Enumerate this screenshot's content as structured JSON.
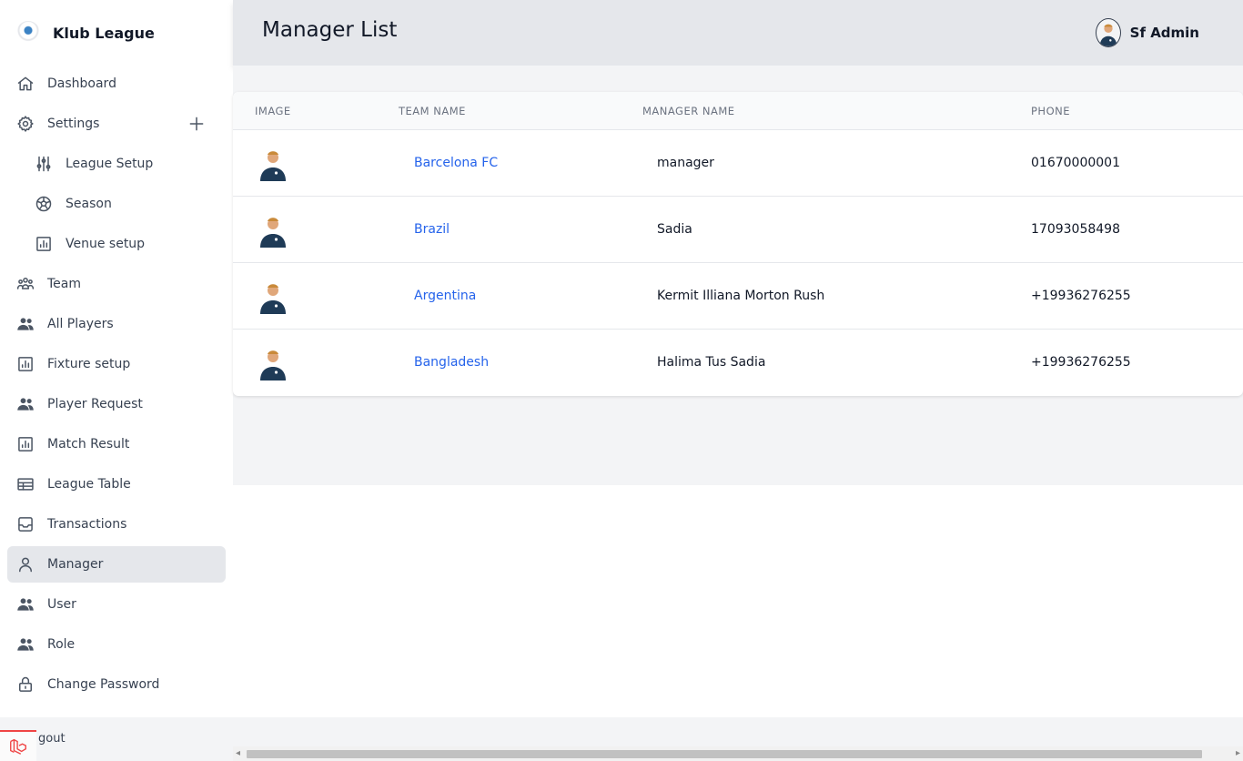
{
  "app": {
    "brand_name": "Klub League",
    "page_title": "Manager List",
    "user_name": "Sf Admin"
  },
  "sidebar": {
    "items": [
      {
        "label": "Dashboard",
        "icon": "home-icon"
      },
      {
        "label": "Settings",
        "icon": "gear-icon"
      },
      {
        "label": "League Setup",
        "icon": "sliders-icon"
      },
      {
        "label": "Season",
        "icon": "soccer-ball-icon"
      },
      {
        "label": "Venue setup",
        "icon": "chart-icon"
      },
      {
        "label": "Team",
        "icon": "team-icon"
      },
      {
        "label": "All Players",
        "icon": "users-icon"
      },
      {
        "label": "Fixture setup",
        "icon": "chart-icon"
      },
      {
        "label": "Player Request",
        "icon": "users-icon"
      },
      {
        "label": "Match Result",
        "icon": "chart-icon"
      },
      {
        "label": "League Table",
        "icon": "table-icon"
      },
      {
        "label": "Transactions",
        "icon": "inbox-icon"
      },
      {
        "label": "Manager",
        "icon": "user-icon"
      },
      {
        "label": "User",
        "icon": "users-icon"
      },
      {
        "label": "Role",
        "icon": "users-icon"
      },
      {
        "label": "Change Password",
        "icon": "lock-icon"
      }
    ],
    "logout_label": "gout"
  },
  "table": {
    "headers": {
      "image": "IMAGE",
      "team_name": "TEAM NAME",
      "manager_name": "MANAGER NAME",
      "phone": "PHONE"
    },
    "rows": [
      {
        "team": "Barcelona FC",
        "manager": "manager",
        "phone": "01670000001"
      },
      {
        "team": "Brazil",
        "manager": "Sadia",
        "phone": "17093058498"
      },
      {
        "team": "Argentina",
        "manager": "Kermit Illiana Morton Rush",
        "phone": "+19936276255"
      },
      {
        "team": "Bangladesh",
        "manager": "Halima Tus Sadia",
        "phone": "+19936276255"
      }
    ]
  },
  "colors": {
    "link": "#2563eb",
    "active_bg": "#e5e7eb",
    "header_bg": "#e5e7eb"
  }
}
